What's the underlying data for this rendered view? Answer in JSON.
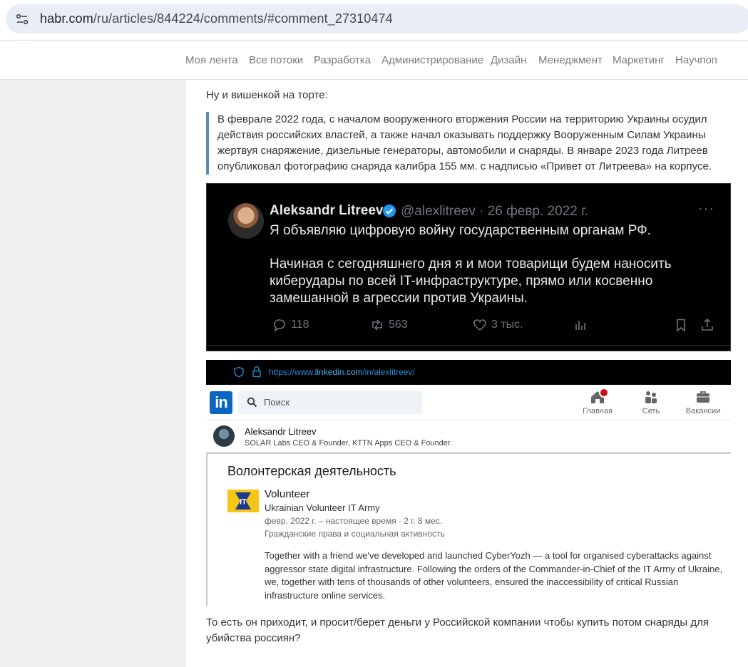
{
  "browser": {
    "url_host": "habr.com",
    "url_path": "/ru/articles/844224/comments/#comment_27310474"
  },
  "nav": {
    "items": [
      "Моя лента",
      "Все потоки",
      "Разработка",
      "Администрирование",
      "Дизайн",
      "Менеджмент",
      "Маркетинг",
      "Научпоп"
    ]
  },
  "comment": {
    "intro": "Ну и вишенкой на торте:",
    "quote": "В феврале 2022 года, с началом вооруженного вторжения России на территорию Украины осудил действия российских властей, а также начал оказывать поддержку Вооруженным Силам Украины жертвуя снаряжение, дизельные генераторы, автомобили и снаряды. В январе 2023 года Литреев опубликовал фотографию снаряда калибра 155 мм. с надписью «Привет от Литреева» на корпусе.",
    "outro": "То есть он приходит, и просит/берет деньги у Российской компании чтобы купить потом снаряды для убийства россиян?"
  },
  "tweet": {
    "name": "Aleksandr Litreev",
    "handle_date": "@alexlitreev · 26 февр. 2022 г.",
    "more": "···",
    "line1": "Я объявляю цифровую войну государственным органам РФ.",
    "body": "Начиная с сегодняшнего дня я и мои товарищи будем наносить кибеpудары по всей IT-инфраструктуре, прямо или косвенно замешанной в агрессии против Украины.",
    "replies": "118",
    "reposts": "563",
    "likes": "3 тыс."
  },
  "linkedin": {
    "url_prefix": "https://www.",
    "url_domain": "linkedin.com",
    "url_path": "/in/alexlitreev/",
    "logo": "in",
    "search_placeholder": "Поиск",
    "nav_home": "Главная",
    "nav_network": "Сеть",
    "nav_jobs": "Вакансии",
    "profile_name": "Aleksandr Litreev",
    "profile_headline": "SOLAR Labs CEO & Founder, KTTN Apps CEO & Founder",
    "section_title": "Волонтерская деятельность",
    "it_logo_text": "IT",
    "role": "Volunteer",
    "org": "Ukrainian Volunteer IT Army",
    "dates": "февр. 2022 г. – настоящее время · 2 г. 8 мес.",
    "cause": "Гражданские права и социальная активность",
    "description": "Together with a friend we've developed and launched CyberYozh — a tool for organised cyberattacks against aggressor state digital infrastructure. Following the orders of the Commander-in-Chief of the IT Army of Ukraine, we, together with tens of thousands of other volunteers, ensured the inaccessibility of critical Russian infrastructure online services."
  }
}
